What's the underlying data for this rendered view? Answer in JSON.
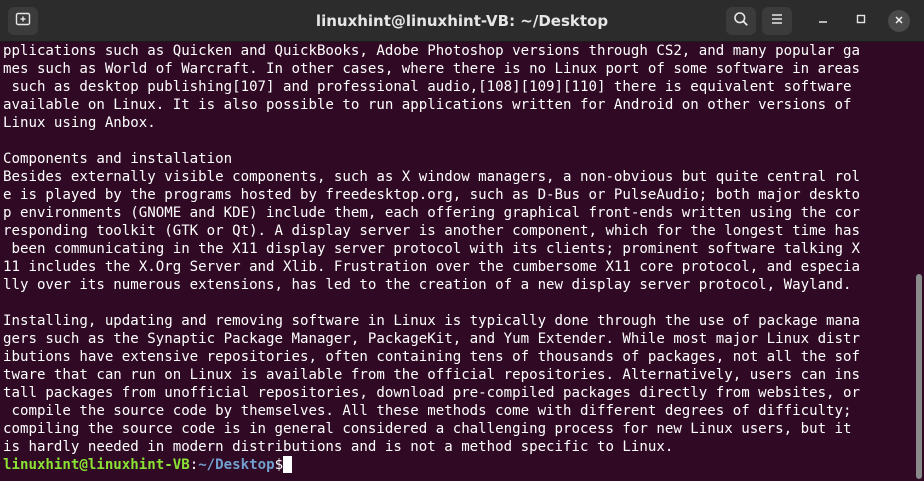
{
  "window": {
    "title": "linuxhint@linuxhint-VB: ~/Desktop"
  },
  "titlebar": {
    "new_tab_icon": "new-tab-icon",
    "search_icon": "search-icon",
    "menu_icon": "hamburger-menu-icon",
    "minimize_icon": "minimize-icon",
    "maximize_icon": "maximize-icon",
    "close_icon": "close-icon"
  },
  "terminal": {
    "lines": [
      "pplications such as Quicken and QuickBooks, Adobe Photoshop versions through CS2, and many popular ga",
      "mes such as World of Warcraft. In other cases, where there is no Linux port of some software in areas",
      " such as desktop publishing[107] and professional audio,[108][109][110] there is equivalent software",
      "available on Linux. It is also possible to run applications written for Android on other versions of",
      "Linux using Anbox.",
      "",
      "Components and installation",
      "Besides externally visible components, such as X window managers, a non-obvious but quite central rol",
      "e is played by the programs hosted by freedesktop.org, such as D-Bus or PulseAudio; both major deskto",
      "p environments (GNOME and KDE) include them, each offering graphical front-ends written using the cor",
      "responding toolkit (GTK or Qt). A display server is another component, which for the longest time has",
      " been communicating in the X11 display server protocol with its clients; prominent software talking X",
      "11 includes the X.Org Server and Xlib. Frustration over the cumbersome X11 core protocol, and especia",
      "lly over its numerous extensions, has led to the creation of a new display server protocol, Wayland.",
      "",
      "Installing, updating and removing software in Linux is typically done through the use of package mana",
      "gers such as the Synaptic Package Manager, PackageKit, and Yum Extender. While most major Linux distr",
      "ibutions have extensive repositories, often containing tens of thousands of packages, not all the sof",
      "tware that can run on Linux is available from the official repositories. Alternatively, users can ins",
      "tall packages from unofficial repositories, download pre-compiled packages directly from websites, or",
      " compile the source code by themselves. All these methods come with different degrees of difficulty;",
      "compiling the source code is in general considered a challenging process for new Linux users, but it",
      "is hardly needed in modern distributions and is not a method specific to Linux."
    ],
    "prompt": {
      "user_host": "linuxhint@linuxhint-VB",
      "separator": ":",
      "path": "~/Desktop",
      "symbol": "$"
    }
  },
  "colors": {
    "background": "#300a24",
    "titlebar": "#2c2c2c",
    "prompt_user": "#8ae234",
    "prompt_path": "#729fcf"
  }
}
